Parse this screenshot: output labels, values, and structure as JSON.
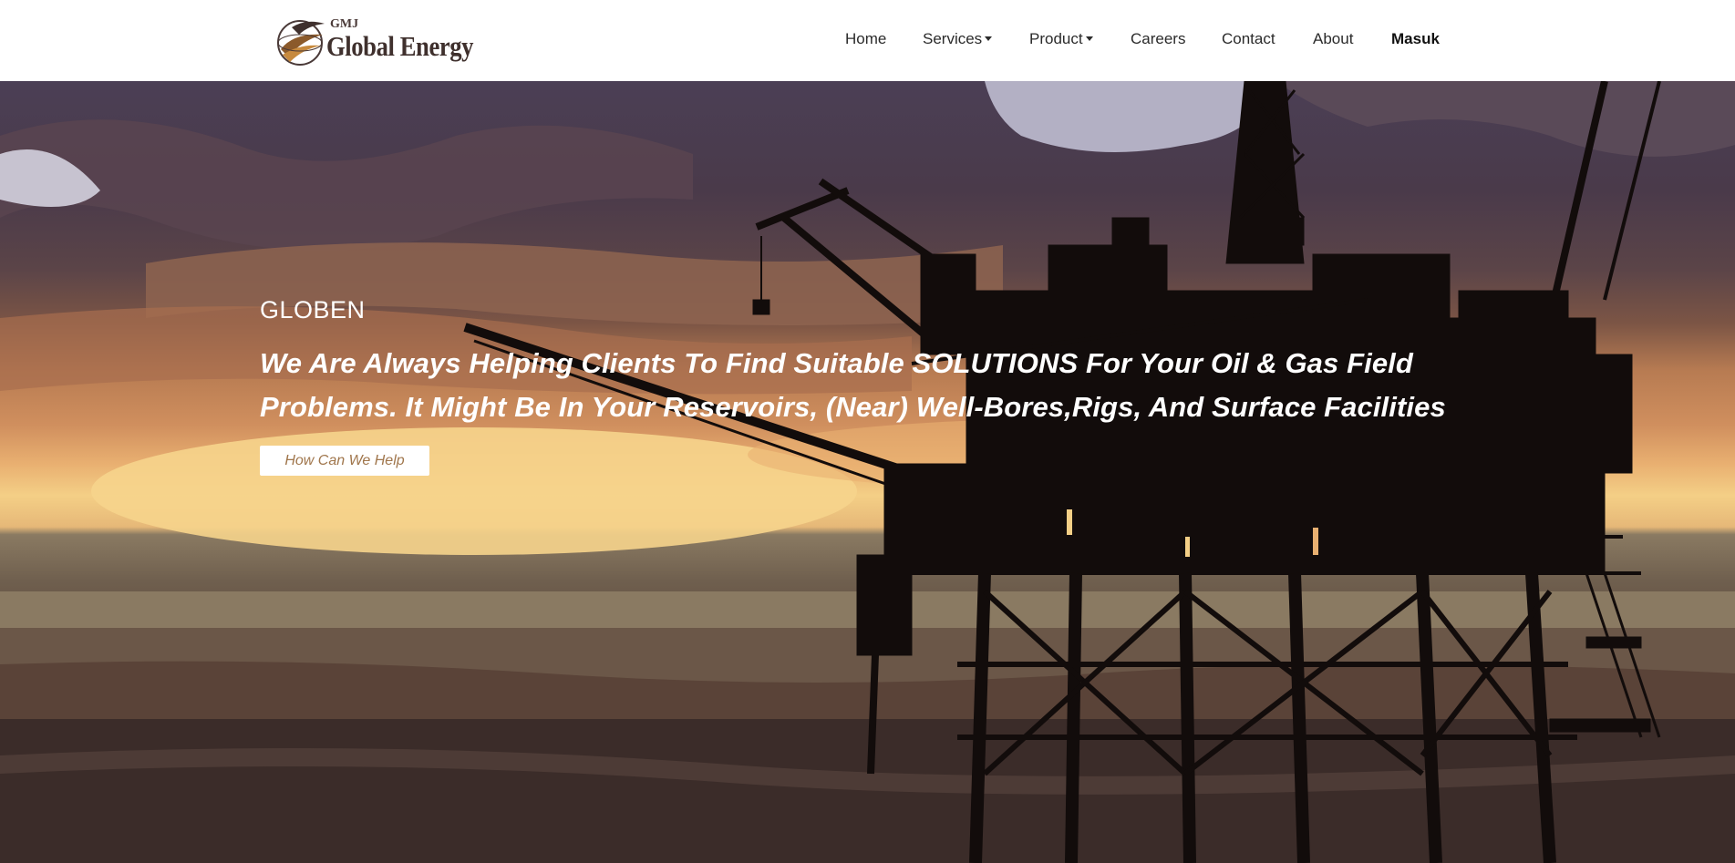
{
  "brand": {
    "logo_icon": "globe-swoosh-logo",
    "small_text": "GMJ",
    "name": "Global Energy"
  },
  "nav": {
    "items": [
      {
        "label": "Home",
        "dropdown": false
      },
      {
        "label": "Services",
        "dropdown": true
      },
      {
        "label": "Product",
        "dropdown": true
      },
      {
        "label": "Careers",
        "dropdown": false
      },
      {
        "label": "Contact",
        "dropdown": false
      },
      {
        "label": "About",
        "dropdown": false
      }
    ],
    "user_label": "Masuk",
    "caret_icon": "caret-down-icon"
  },
  "hero": {
    "background": "offshore oil rig silhouette at sunset",
    "kicker": "GLOBEN",
    "headline": "We Are Always Helping Clients To Find Suitable SOLUTIONS For Your Oil & Gas Field Problems. It Might Be In Your Reservoirs, (Near) Well-Bores,Rigs, And Surface Facilities",
    "cta_label": "How Can We Help"
  },
  "colors": {
    "nav_bg": "#ffffff",
    "nav_text": "#2b2b2b",
    "hero_text": "#ffffff",
    "cta_text": "#a0764c",
    "sky_dark": "#4b3f55",
    "sunset": "#f4cf86",
    "rig_silhouette": "#120c0b"
  }
}
